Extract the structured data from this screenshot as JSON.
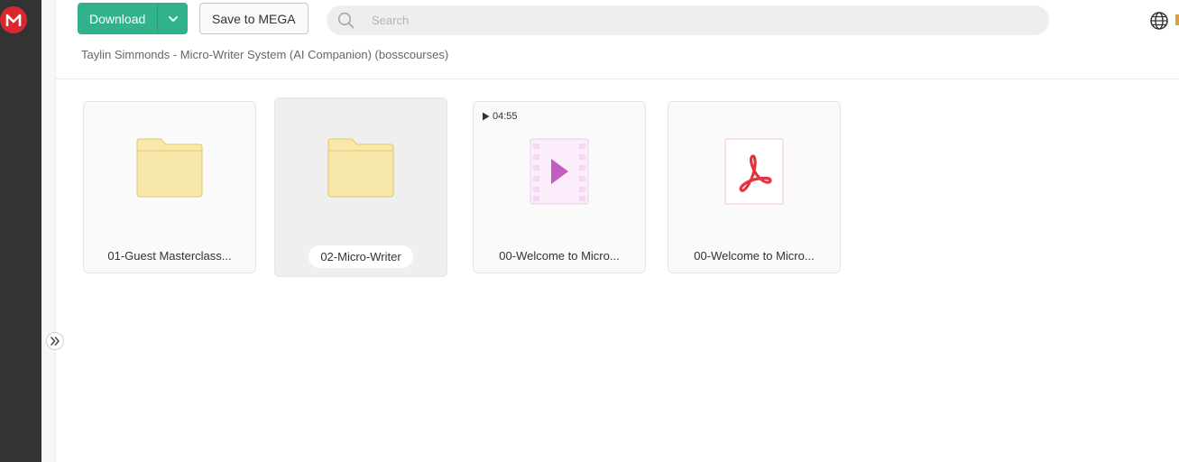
{
  "toolbar": {
    "download_label": "Download",
    "save_label": "Save to MEGA"
  },
  "search": {
    "placeholder": "Search"
  },
  "breadcrumb": "Taylin Simmonds - Micro-Writer System (AI Companion) (bosscourses)",
  "items": [
    {
      "type": "folder",
      "name": "01-Guest Masterclass...",
      "icon": "folder-icon"
    },
    {
      "type": "folder",
      "name": "02-Micro-Writer",
      "icon": "folder-icon",
      "selected": true
    },
    {
      "type": "video",
      "name": "00-Welcome to Micro...",
      "icon": "video-file-icon",
      "duration": "04:55"
    },
    {
      "type": "pdf",
      "name": "00-Welcome to Micro...",
      "icon": "pdf-file-icon"
    }
  ],
  "colors": {
    "accent": "#31b18c",
    "brand": "#d9272e",
    "folder": "#f7e7a6",
    "video": "#c35ec1",
    "pdf": "#e0363f"
  }
}
